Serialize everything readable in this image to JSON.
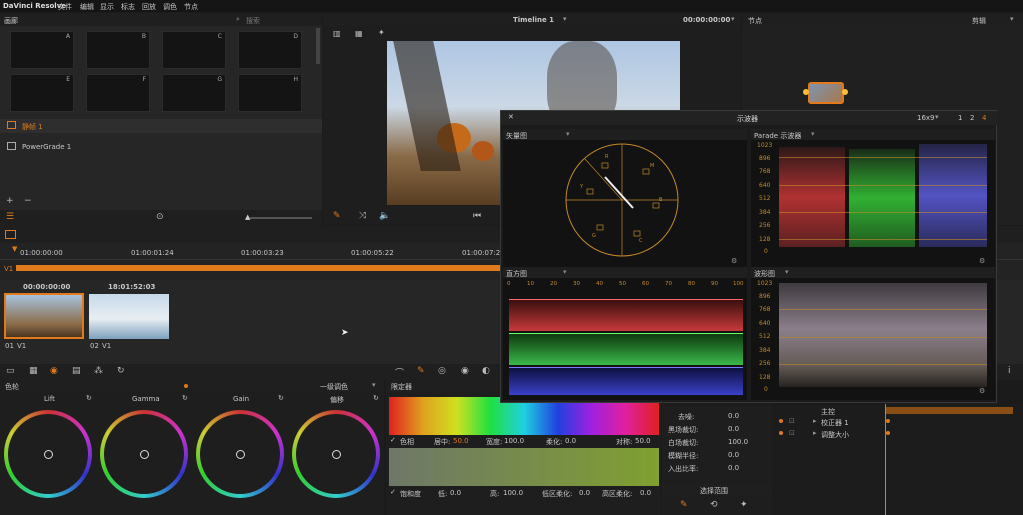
{
  "menubar": {
    "app": "DaVinci Resolve",
    "items": [
      "文件",
      "编辑",
      "显示",
      "标志",
      "回放",
      "调色",
      "节点"
    ]
  },
  "gallery": {
    "title": "画廊",
    "search_placeholder": "搜索",
    "stills": [
      "A",
      "B",
      "C",
      "D",
      "E",
      "F",
      "G",
      "H"
    ],
    "albums": [
      "静帧 1",
      "PowerGrade 1"
    ]
  },
  "viewer": {
    "timeline_name": "Timeline 1",
    "timecode": "00:00:00:00"
  },
  "nodes": {
    "title": "节点",
    "mode": "剪辑"
  },
  "timeline_ruler": {
    "times": [
      "01:00:00:00",
      "01:00:01:24",
      "01:00:03:23",
      "01:00:05:22",
      "01:00:07:21"
    ],
    "track": "V1"
  },
  "clips": [
    {
      "timecode": "00:00:00:00",
      "number": "01",
      "track": "V1"
    },
    {
      "timecode": "18:01:52:03",
      "number": "02",
      "track": "V1"
    }
  ],
  "scopes": {
    "title": "示波器",
    "layout_label": "16x9",
    "layout_options": [
      "1",
      "2",
      "4"
    ],
    "vectorscope": {
      "title": "矢量图",
      "targets": [
        "R",
        "M",
        "B",
        "C",
        "G",
        "Y"
      ]
    },
    "parade": {
      "title": "Parade 示波器"
    },
    "histogram": {
      "title": "直方图",
      "ticks": [
        "0",
        "10",
        "20",
        "30",
        "40",
        "50",
        "60",
        "70",
        "80",
        "90",
        "100"
      ]
    },
    "waveform": {
      "title": "波形图"
    },
    "scale": [
      "1023",
      "896",
      "768",
      "640",
      "512",
      "384",
      "256",
      "128",
      "0"
    ]
  },
  "color_wheels": {
    "title": "色轮",
    "mode": "一级调色",
    "wheels": [
      "Lift",
      "Gamma",
      "Gain",
      "偏移"
    ]
  },
  "qualifier": {
    "title": "限定器",
    "hue_row": {
      "name": "色相",
      "center_label": "居中:",
      "center_value": "50.0",
      "width_label": "宽度:",
      "width_value": "100.0",
      "soft_label": "柔化:",
      "soft_value": "0.0",
      "sym_label": "对称:",
      "sym_value": "50.0"
    },
    "sat_row": {
      "name": "饱和度",
      "low_label": "低:",
      "low_value": "0.0",
      "high_label": "高:",
      "high_value": "100.0",
      "lowsoft_label": "低区柔化:",
      "lowsoft_value": "0.0",
      "highsoft_label": "高区柔化:",
      "highsoft_value": "0.0"
    }
  },
  "matte": {
    "params": [
      {
        "label": "去噪:",
        "value": "0.0"
      },
      {
        "label": "黑场裁切:",
        "value": "0.0"
      },
      {
        "label": "白场裁切:",
        "value": "100.0"
      },
      {
        "label": "模糊半径:",
        "value": "0.0"
      },
      {
        "label": "入出比率:",
        "value": "0.0"
      }
    ],
    "selection_label": "选择范围"
  },
  "keyframes": {
    "master": "主控",
    "rows": [
      "校正器 1",
      "调整大小"
    ]
  },
  "colors": {
    "accent": "#e07a1c",
    "panel": "#262626",
    "background": "#1b1b1b"
  }
}
